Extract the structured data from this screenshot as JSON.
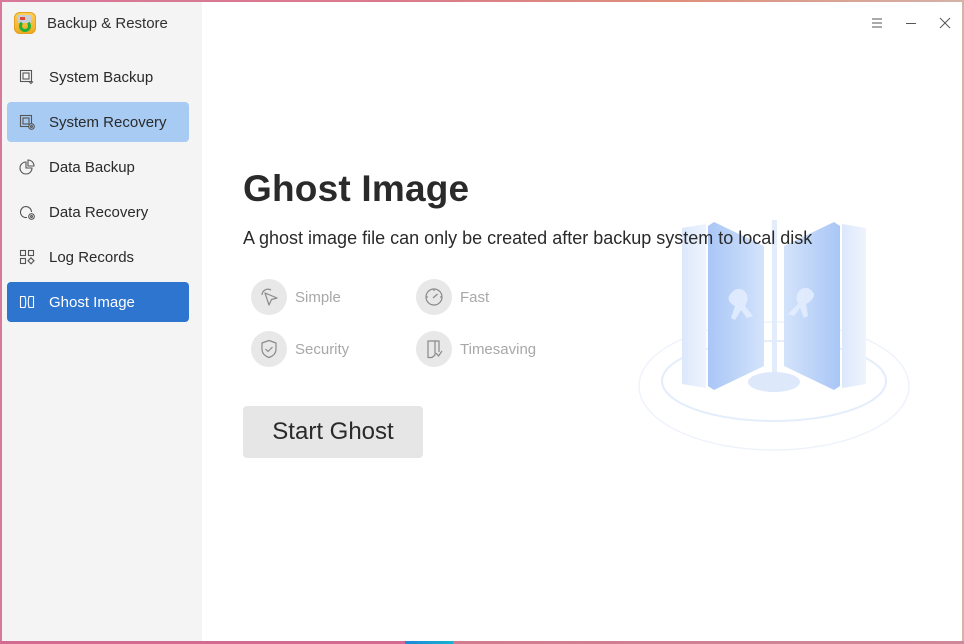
{
  "app": {
    "title": "Backup & Restore",
    "logo_icon": "backup-restore-logo-icon"
  },
  "window_controls": {
    "menu_icon": "hamburger-menu-icon",
    "minimize_icon": "minimize-icon",
    "close_icon": "close-icon"
  },
  "sidebar": {
    "items": [
      {
        "id": "system-backup",
        "label": "System Backup",
        "icon": "system-backup-icon",
        "state": "normal"
      },
      {
        "id": "system-recovery",
        "label": "System Recovery",
        "icon": "system-recovery-icon",
        "state": "hover"
      },
      {
        "id": "data-backup",
        "label": "Data Backup",
        "icon": "pie-chart-icon",
        "state": "normal"
      },
      {
        "id": "data-recovery",
        "label": "Data Recovery",
        "icon": "data-recovery-icon",
        "state": "normal"
      },
      {
        "id": "log-records",
        "label": "Log Records",
        "icon": "grid-icon",
        "state": "normal"
      },
      {
        "id": "ghost-image",
        "label": "Ghost Image",
        "icon": "ghost-image-icon",
        "state": "active"
      }
    ]
  },
  "main": {
    "title": "Ghost Image",
    "description": "A ghost image file can only be created after backup system to local disk",
    "features": [
      {
        "label": "Simple",
        "icon": "cursor-pointer-icon"
      },
      {
        "label": "Fast",
        "icon": "speedometer-icon"
      },
      {
        "label": "Security",
        "icon": "shield-check-icon"
      },
      {
        "label": "Timesaving",
        "icon": "download-arrow-icon"
      }
    ],
    "start_button": "Start Ghost"
  },
  "colors": {
    "active_nav": "#2e75cf",
    "hover_nav": "#a8cbf4",
    "sidebar_bg": "#f4f4f4",
    "button_bg": "#e6e6e6"
  }
}
